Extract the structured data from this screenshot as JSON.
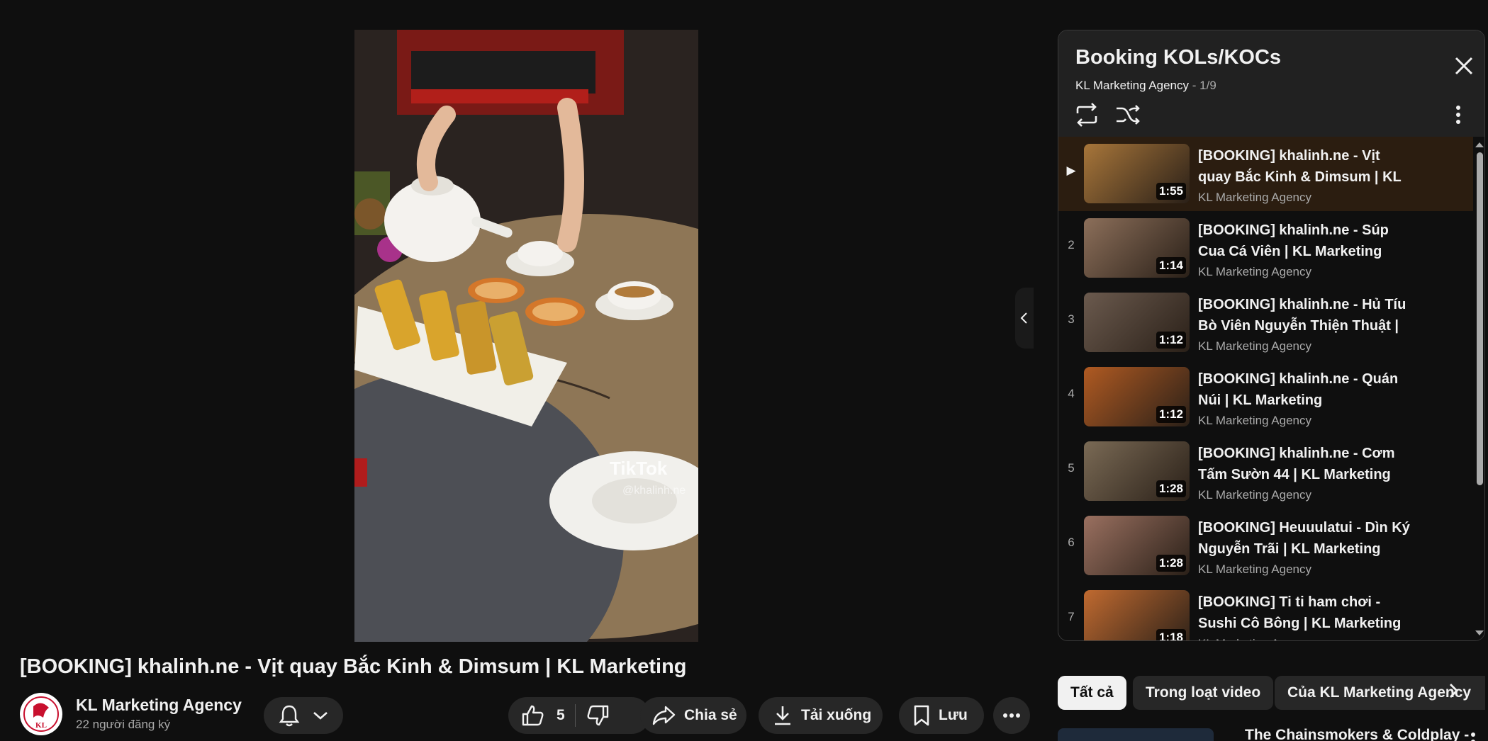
{
  "video": {
    "title": "[BOOKING] khalinh.ne - Vịt quay Bắc Kinh & Dimsum | KL Marketing",
    "watermark": "TikTok",
    "watermark_handle": "@khalinh.ne"
  },
  "channel": {
    "name": "KL Marketing Agency",
    "subscribers": "22 người đăng ký",
    "avatar_text": "KL"
  },
  "actions": {
    "like_count": "5",
    "share_label": "Chia sẻ",
    "download_label": "Tải xuống",
    "save_label": "Lưu"
  },
  "playlist": {
    "title": "Booking KOLs/KOCs",
    "owner": "KL Marketing Agency",
    "position": "1/9",
    "items": [
      {
        "index": "▶",
        "title": "[BOOKING] khalinh.ne - Vịt quay Bắc Kinh & Dimsum | KL Marketing",
        "channel": "KL Marketing Agency",
        "duration": "1:55",
        "color": "#a8763a",
        "active": true
      },
      {
        "index": "2",
        "title": "[BOOKING] khalinh.ne - Súp Cua Cá Viên | KL Marketing",
        "channel": "KL Marketing Agency",
        "duration": "1:14",
        "color": "#8c6f5a"
      },
      {
        "index": "3",
        "title": "[BOOKING] khalinh.ne - Hủ Tíu Bò Viên Nguyễn Thiện Thuật | KL Marketing",
        "channel": "KL Marketing Agency",
        "duration": "1:12",
        "color": "#6b5a4e"
      },
      {
        "index": "4",
        "title": "[BOOKING] khalinh.ne - Quán Núi | KL Marketing",
        "channel": "KL Marketing Agency",
        "duration": "1:12",
        "color": "#b05a22"
      },
      {
        "index": "5",
        "title": "[BOOKING] khalinh.ne - Cơm Tấm Sườn 44 | KL Marketing",
        "channel": "KL Marketing Agency",
        "duration": "1:28",
        "color": "#7a6a55"
      },
      {
        "index": "6",
        "title": "[BOOKING] Heuuulatui - Dìn Ký Nguyễn Trãi | KL Marketing",
        "channel": "KL Marketing Agency",
        "duration": "1:28",
        "color": "#9a7060"
      },
      {
        "index": "7",
        "title": "[BOOKING] Ti ti ham chơi - Sushi Cô Bông | KL Marketing",
        "channel": "KL Marketing Agency",
        "duration": "1:18",
        "color": "#c06a30"
      }
    ]
  },
  "chips": [
    "Tất cả",
    "Trong loạt video",
    "Của KL Marketing Agency"
  ],
  "next_video": {
    "title": "The Chainsmokers & Coldplay -"
  },
  "colors": {
    "background": "#0f0f0f",
    "surface": "#272727",
    "active_item": "#2b1d10"
  }
}
